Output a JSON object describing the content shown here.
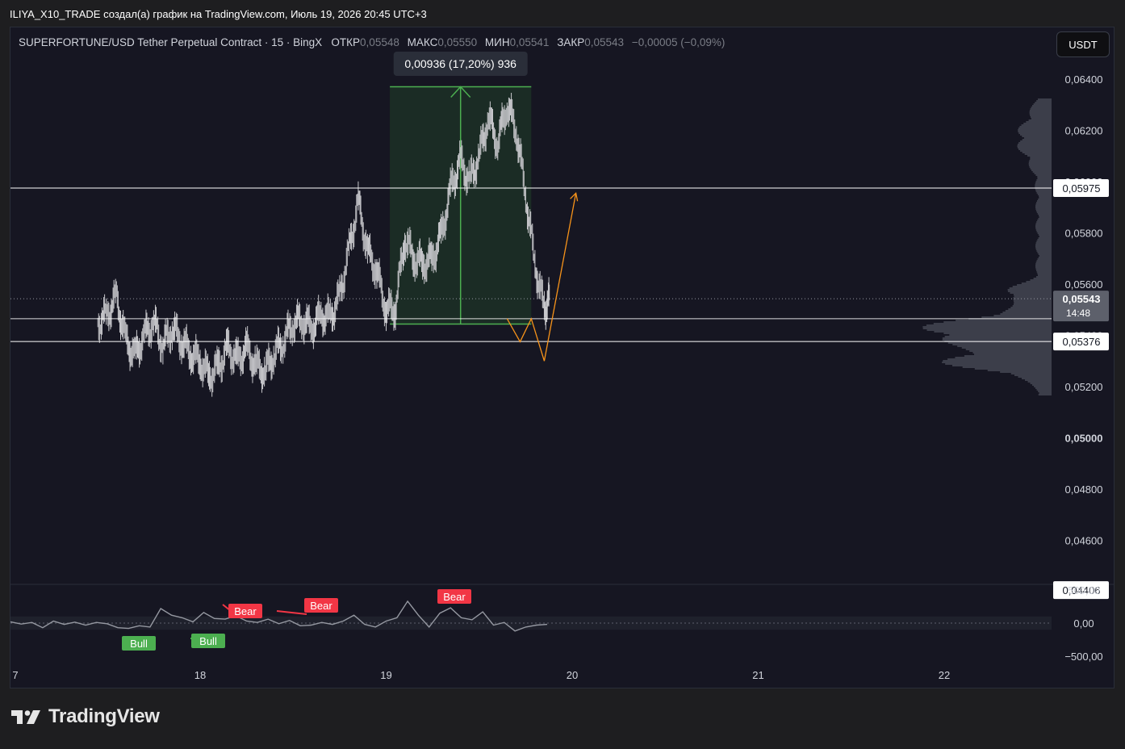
{
  "header": {
    "caption": "ILIYA_X10_TRADE создал(а) график на TradingView.com, Июль 19, 2026 20:45 UTC+3"
  },
  "legend": {
    "symbol": "SUPERFORTUNE/USD Tether Perpetual Contract · 15 · BingX",
    "open_label": "ОТКР",
    "open": "0,05548",
    "high_label": "МАКС",
    "high": "0,05550",
    "low_label": "МИН",
    "low": "0,05541",
    "close_label": "ЗАКР",
    "close": "0,05543",
    "change": "−0,00005 (−0,09%)"
  },
  "currency_button": "USDT",
  "brand": "TradingView",
  "colors": {
    "up": "#4caf50",
    "down": "#f23645",
    "orange": "#f7931a",
    "panel": "#161622",
    "line": "#ffffff"
  },
  "chart_data": [
    {
      "type": "candlestick",
      "timeframe": "15",
      "x_ticks": [
        "7",
        "18",
        "19",
        "20",
        "21",
        "22"
      ],
      "y_ticks": [
        "0,06400",
        "0,06200",
        "0,06000",
        "0,05800",
        "0,05600",
        "0,05400",
        "0,05200",
        "0,05000",
        "0,04800",
        "0,04600"
      ],
      "ylim": [
        0.0442,
        0.0658
      ],
      "price_series_approx": [
        [
          17.45,
          0.0545
        ],
        [
          17.5,
          0.0548
        ],
        [
          17.55,
          0.0555
        ],
        [
          17.6,
          0.0538
        ],
        [
          17.65,
          0.0532
        ],
        [
          17.7,
          0.054
        ],
        [
          17.75,
          0.0545
        ],
        [
          17.8,
          0.0536
        ],
        [
          17.85,
          0.0543
        ],
        [
          17.9,
          0.0538
        ],
        [
          17.95,
          0.0533
        ],
        [
          18.0,
          0.053
        ],
        [
          18.05,
          0.0524
        ],
        [
          18.1,
          0.0528
        ],
        [
          18.15,
          0.0535
        ],
        [
          18.2,
          0.053
        ],
        [
          18.25,
          0.0535
        ],
        [
          18.3,
          0.0528
        ],
        [
          18.35,
          0.0526
        ],
        [
          18.4,
          0.0533
        ],
        [
          18.45,
          0.0538
        ],
        [
          18.5,
          0.0545
        ],
        [
          18.55,
          0.0546
        ],
        [
          18.6,
          0.0543
        ],
        [
          18.65,
          0.0548
        ],
        [
          18.7,
          0.0547
        ],
        [
          18.75,
          0.0555
        ],
        [
          18.8,
          0.0573
        ],
        [
          18.85,
          0.0592
        ],
        [
          18.9,
          0.0573
        ],
        [
          18.95,
          0.0565
        ],
        [
          19.0,
          0.055
        ],
        [
          19.05,
          0.0551
        ],
        [
          19.1,
          0.0578
        ],
        [
          19.15,
          0.057
        ],
        [
          19.2,
          0.0568
        ],
        [
          19.25,
          0.057
        ],
        [
          19.3,
          0.058
        ],
        [
          19.35,
          0.0598
        ],
        [
          19.4,
          0.0608
        ],
        [
          19.45,
          0.06
        ],
        [
          19.5,
          0.061
        ],
        [
          19.55,
          0.0625
        ],
        [
          19.6,
          0.0615
        ],
        [
          19.65,
          0.063
        ],
        [
          19.7,
          0.062
        ],
        [
          19.75,
          0.0595
        ],
        [
          19.8,
          0.0568
        ],
        [
          19.85,
          0.055
        ],
        [
          19.88,
          0.05543
        ]
      ],
      "last_price": "0,05543",
      "countdown": "14:48",
      "price_labels": [
        "0,05975",
        "0,05376",
        "0,04406"
      ],
      "horizontal_lines": [
        0.05975,
        0.05465,
        0.05376
      ],
      "measure_box": {
        "label": "0,00936 (17,20%) 936",
        "from": 0.05444,
        "to": 0.0637,
        "x_from": 19.02,
        "x_to": 19.78
      },
      "projection_path": [
        [
          19.65,
          0.05465
        ],
        [
          19.72,
          0.05375
        ],
        [
          19.78,
          0.05465
        ],
        [
          19.85,
          0.053
        ],
        [
          20.02,
          0.05955
        ]
      ]
    },
    {
      "type": "line",
      "name": "oscillator",
      "y_ticks": [
        "500,00",
        "0,00",
        "−500,00"
      ],
      "ylim": [
        -500,
        500
      ],
      "values_approx": [
        20,
        -15,
        10,
        -70,
        30,
        -20,
        15,
        -30,
        10,
        -10,
        -70,
        -80,
        -40,
        -60,
        220,
        120,
        80,
        20,
        160,
        70,
        60,
        110,
        30,
        10,
        60,
        -10,
        40,
        -40,
        -30,
        10,
        -20,
        30,
        120,
        -20,
        -60,
        30,
        80,
        330,
        120,
        -60,
        150,
        230,
        80,
        50,
        170,
        -30,
        10,
        -120,
        -60,
        -30,
        -20
      ],
      "signals": [
        {
          "label": "Bull",
          "kind": "bull",
          "x": 17.68
        },
        {
          "label": "Bear",
          "kind": "bear",
          "x": 18.25
        },
        {
          "label": "Bull",
          "kind": "bull",
          "x": 18.05
        },
        {
          "label": "Bear",
          "kind": "bear",
          "x": 18.65
        },
        {
          "label": "Bear",
          "kind": "bear",
          "x": 19.37
        }
      ]
    }
  ]
}
